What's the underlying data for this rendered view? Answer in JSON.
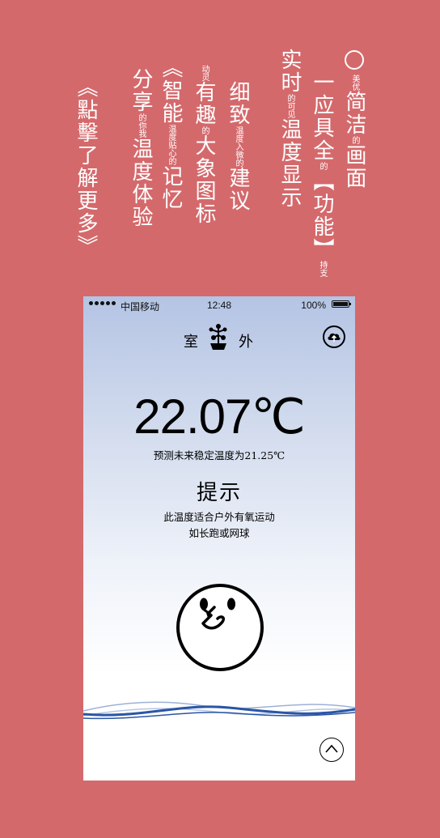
{
  "poster": {
    "col_a": {
      "circle": "",
      "sm1": "美优",
      "big1": "简洁",
      "sm2": "的",
      "big2": "画面"
    },
    "col_b": {
      "big1": "一应具全",
      "sm1": "的",
      "big2": "【功能】",
      "sm2": "持支"
    },
    "col_c": {
      "big1": "实时",
      "sm1": "的可见",
      "big2": "温度显示"
    },
    "col_d": {
      "big1": "细致",
      "sm1": "温度入微的",
      "big2": "建议"
    },
    "col_e": {
      "sm1": "动灵",
      "big1": "有趣",
      "sm2": "的",
      "big2": "大象图标"
    },
    "col_f": {
      "big1": "《智能",
      "sm1": "温度贴心的",
      "big2": "记忆"
    },
    "col_g": {
      "big1": "分享",
      "sm1": "的你我",
      "big2": "温度体验"
    },
    "col_h": {
      "big1": "《點擊了解更多》"
    }
  },
  "statusbar": {
    "carrier": "中国移动",
    "time": "12:48",
    "battery": "100%"
  },
  "header": {
    "tab_room": "室",
    "tab_outdoor": "外"
  },
  "main": {
    "temperature": "22.07℃",
    "forecast": "预测未来稳定温度为21.25℃",
    "hint_title": "提示",
    "hint_line1": "此温度适合户外有氧运动",
    "hint_line2": "如长跑或网球"
  },
  "icons": {
    "upload": "cloud-upload-icon",
    "plant": "plant-bonsai-icon",
    "mascot": "mascot-face-icon",
    "scroll_up": "chevron-up-icon"
  },
  "colors": {
    "background": "#d4696c",
    "wave_primary": "#2a56a5",
    "wave_secondary": "#9db1d8"
  }
}
